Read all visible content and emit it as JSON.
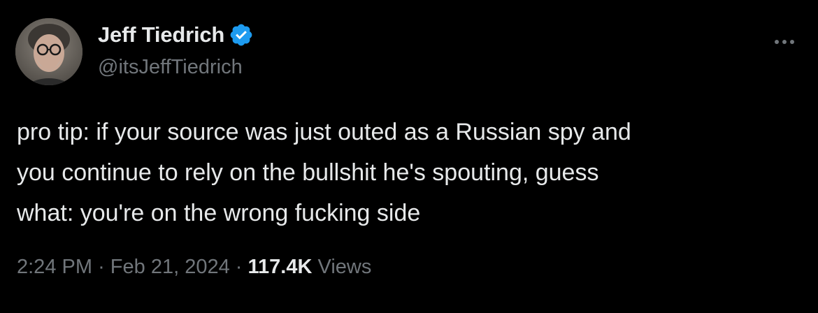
{
  "tweet": {
    "author": {
      "display_name": "Jeff Tiedrich",
      "handle": "@itsJeffTiedrich",
      "verified": true,
      "verified_badge_color": "#1d9bf0"
    },
    "text_lines": [
      "pro tip: if your source was just outed as a Russian spy and",
      "you continue to rely on the bullshit he's spouting, guess",
      "what: you're on the wrong fucking side"
    ],
    "meta": {
      "time": "2:24 PM",
      "separator": "·",
      "date": "Feb 21, 2024",
      "views_count": "117.4K",
      "views_label": "Views"
    },
    "more_icon": "more-horizontal-icon"
  },
  "colors": {
    "background": "#000000",
    "primary_text": "#e7e9ea",
    "secondary_text": "#71767b",
    "accent": "#1d9bf0"
  }
}
